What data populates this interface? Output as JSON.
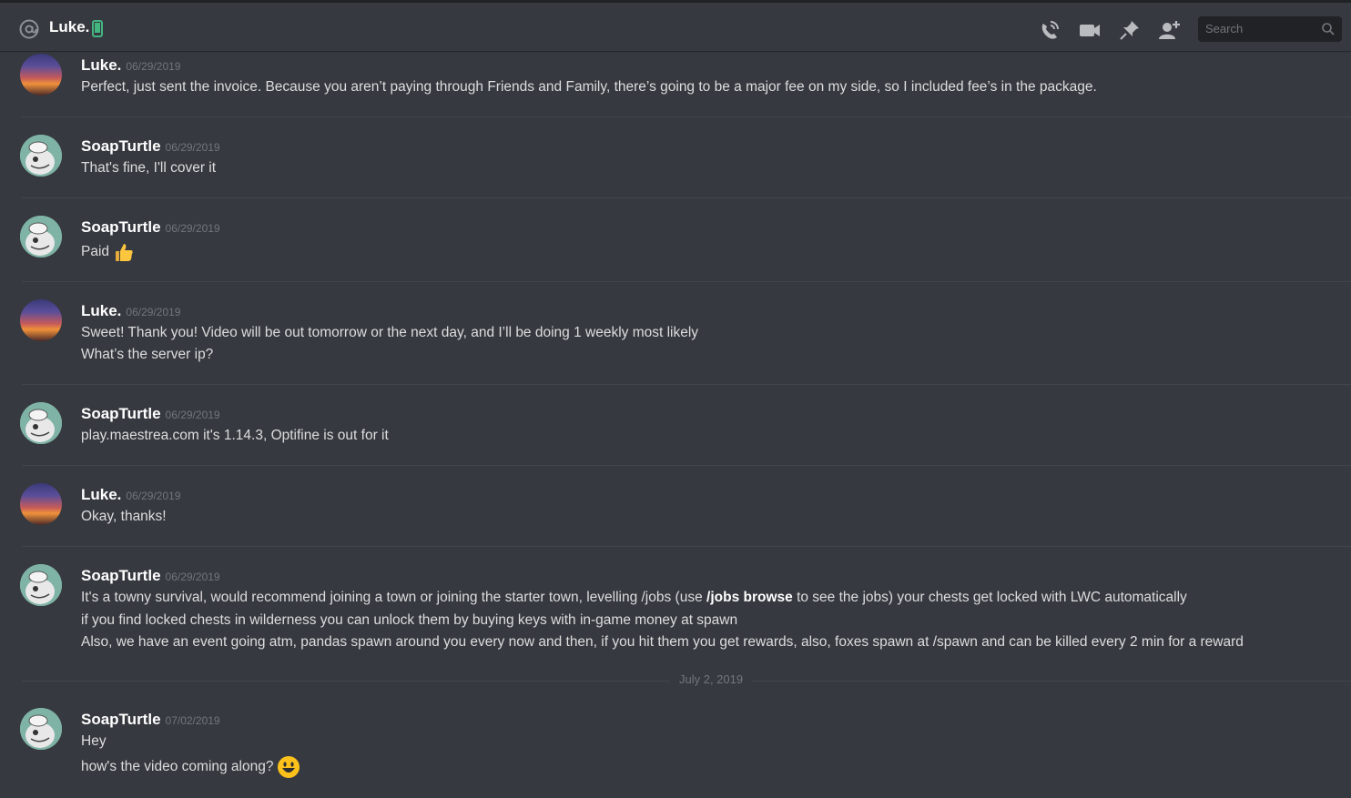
{
  "header": {
    "title": "Luke.",
    "search_placeholder": "Search",
    "icons": [
      "at-icon",
      "mobile-icon",
      "phone-call-icon",
      "video-call-icon",
      "pin-icon",
      "add-friend-icon",
      "search-icon"
    ]
  },
  "colors": {
    "background": "#36393f",
    "author": "#ffffff",
    "timestamp": "#72767d",
    "online_mobile": "#43b581"
  },
  "messages": [
    {
      "author": "Luke.",
      "timestamp": "06/29/2019",
      "lines": [
        "Perfect, just sent the invoice. Because you aren’t paying through Friends and Family, there’s going to be a major fee on my side, so I included fee’s in the package."
      ]
    },
    {
      "author": "SoapTurtle",
      "timestamp": "06/29/2019",
      "lines": [
        "That's fine, I'll cover it"
      ]
    },
    {
      "author": "SoapTurtle",
      "timestamp": "06/29/2019",
      "lines": [
        "Paid"
      ]
    },
    {
      "author": "Luke.",
      "timestamp": "06/29/2019",
      "lines": [
        "Sweet! Thank you! Video will be out tomorrow or the next day, and I’ll be doing 1 weekly most likely",
        "What’s the server ip?"
      ]
    },
    {
      "author": "SoapTurtle",
      "timestamp": "06/29/2019",
      "lines": [
        "play.maestrea.com it's 1.14.3, Optifine is out for it"
      ]
    },
    {
      "author": "Luke.",
      "timestamp": "06/29/2019",
      "lines": [
        "Okay, thanks!"
      ]
    },
    {
      "author": "SoapTurtle",
      "timestamp": "06/29/2019",
      "line1_pre": "It's a towny survival, would recommend joining a town or joining the starter town, levelling /jobs (use ",
      "line1_bold": "/jobs browse",
      "line1_post": " to see the jobs) your chests get locked with LWC automatically",
      "lines": [
        "if you find locked chests in wilderness you can unlock them by buying keys with in-game money at spawn",
        "Also, we have an event going atm, pandas spawn around you every now and then, if you hit them you get rewards, also, foxes spawn at /spawn and can be killed every 2 min for a reward"
      ]
    },
    {
      "author": "SoapTurtle",
      "timestamp": "07/02/2019",
      "lines": [
        "Hey",
        "how's the video coming along?"
      ]
    }
  ],
  "date_separator": "July 2, 2019"
}
